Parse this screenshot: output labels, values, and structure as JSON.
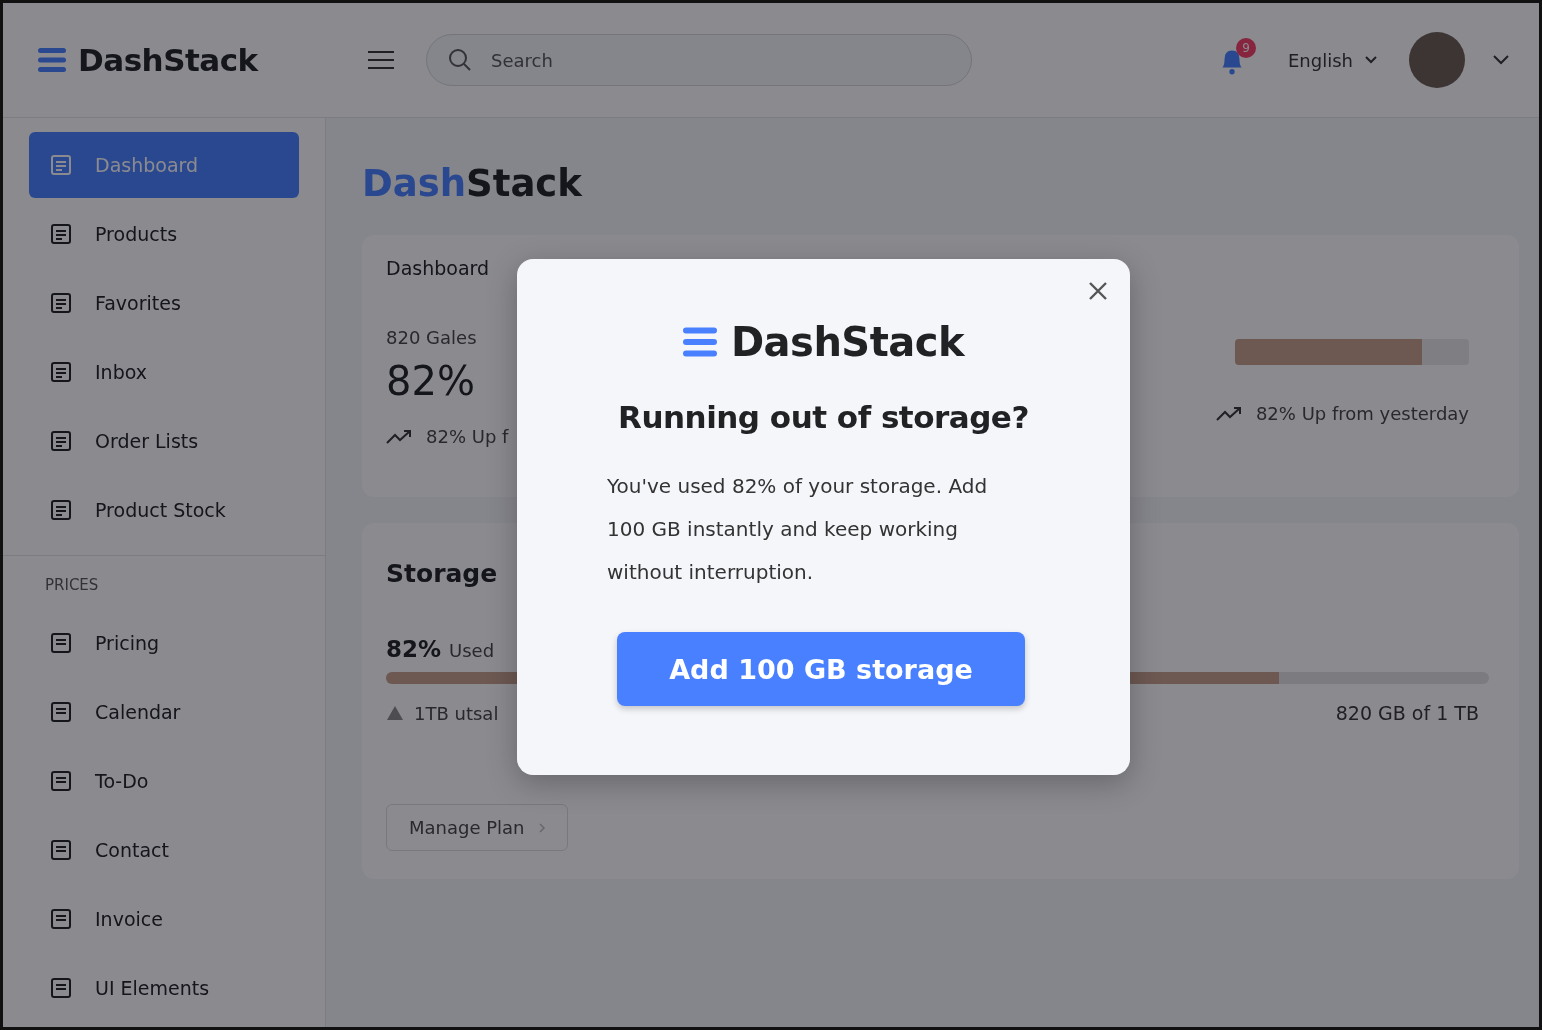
{
  "header": {
    "logo": "DashStack",
    "search": {
      "placeholder": "Search"
    },
    "notifications": "9",
    "language": "English"
  },
  "sidebar": {
    "items": [
      {
        "label": "Dashboard",
        "selected": true
      },
      {
        "label": "Products",
        "selected": false
      },
      {
        "label": "Favorites",
        "selected": false
      },
      {
        "label": "Inbox",
        "selected": false
      },
      {
        "label": "Order Lists",
        "selected": false
      },
      {
        "label": "Product Stock",
        "selected": false
      }
    ],
    "section": "PRICES",
    "section_items": [
      {
        "label": "Pricing",
        "selected": false
      },
      {
        "label": "Calendar",
        "selected": false
      },
      {
        "label": "To-Do",
        "selected": false
      },
      {
        "label": "Contact",
        "selected": false
      },
      {
        "label": "Invoice",
        "selected": false
      },
      {
        "label": "UI Elements",
        "selected": false
      }
    ]
  },
  "page": {
    "title_prefix": "Dash",
    "title_rest": "Stack",
    "stats": {
      "label": "Dashboard",
      "caption": "820 Gales",
      "value": "82%",
      "trend_left": "82% Up f",
      "level": 0.8,
      "trend_right": "82% Up from yesterday"
    },
    "storage": {
      "title": "Storage",
      "percent": "82%",
      "used": "Used",
      "level": 0.81,
      "note": "1TB utsal",
      "total": "820 GB of 1 TB",
      "button": "Manage Plan"
    }
  },
  "modal": {
    "logo": "DashStack",
    "title": "Running out of storage?",
    "text": "You've used 82% of your storage. Add 100 GB instantly and keep working without interruption.",
    "button": "Add 100 GB storage"
  }
}
